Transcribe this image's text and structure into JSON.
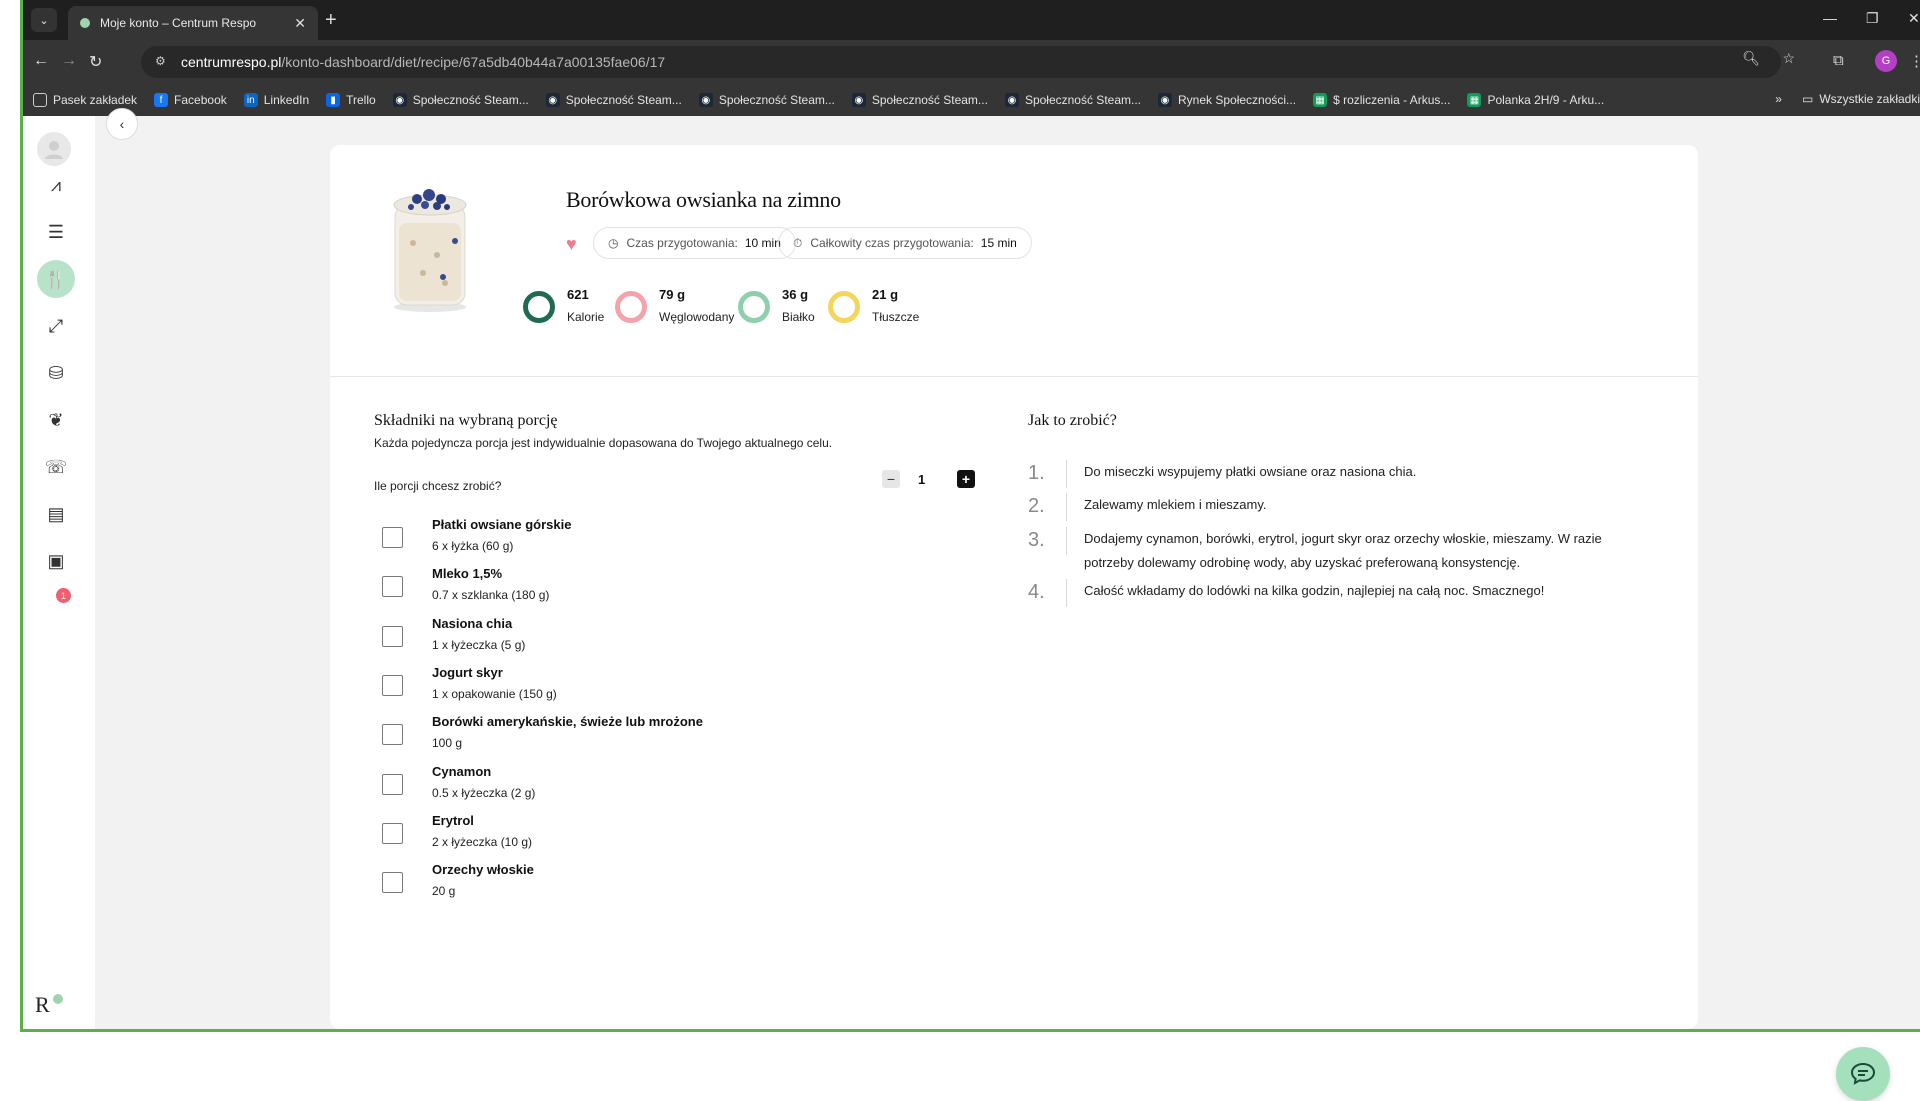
{
  "browser": {
    "tab_title": "Moje konto – Centrum Respo",
    "url_domain": "centrumrespo.pl",
    "url_path": "/konto-dashboard/diet/recipe/67a5db40b44a7a00135fae06/17",
    "profile_initial": "G",
    "bookmarks": [
      {
        "label": "Pasek zakładek",
        "icon": "folder-icon",
        "color": "#353535"
      },
      {
        "label": "Facebook",
        "icon": "facebook-icon",
        "color": "#1877f2"
      },
      {
        "label": "LinkedIn",
        "icon": "linkedin-icon",
        "color": "#0a66c2"
      },
      {
        "label": "Trello",
        "icon": "trello-icon",
        "color": "#0c66e4"
      },
      {
        "label": "Społeczność Steam...",
        "icon": "steam-icon",
        "color": "#1b2838"
      },
      {
        "label": "Społeczność Steam...",
        "icon": "steam-icon",
        "color": "#1b2838"
      },
      {
        "label": "Społeczność Steam...",
        "icon": "steam-icon",
        "color": "#1b2838"
      },
      {
        "label": "Społeczność Steam...",
        "icon": "steam-icon",
        "color": "#1b2838"
      },
      {
        "label": "Społeczność Steam...",
        "icon": "steam-icon",
        "color": "#1b2838"
      },
      {
        "label": "Rynek Społeczności...",
        "icon": "steam-icon",
        "color": "#1b2838"
      },
      {
        "label": "$ rozliczenia - Arkus...",
        "icon": "sheets-icon",
        "color": "#0f9d58"
      },
      {
        "label": "Polanka 2H/9 - Arku...",
        "icon": "sheets-icon",
        "color": "#0f9d58"
      }
    ],
    "all_bookmarks_label": "Wszystkie zakładki"
  },
  "sidebar": {
    "items": [
      {
        "name": "progress-chart-icon",
        "glyph": "⩘",
        "active": false
      },
      {
        "name": "chat-icon",
        "glyph": "☰",
        "active": false
      },
      {
        "name": "diet-cutlery-icon",
        "glyph": "🍴",
        "active": true
      },
      {
        "name": "training-dumbbell-icon",
        "glyph": "⤢",
        "active": false
      },
      {
        "name": "shopping-bag-icon",
        "glyph": "⛁",
        "active": false
      },
      {
        "name": "leaf-hand-icon",
        "glyph": "❦",
        "active": false
      },
      {
        "name": "phone-call-icon",
        "glyph": "☏",
        "active": false
      },
      {
        "name": "clipboard-icon",
        "glyph": "▤",
        "active": false
      },
      {
        "name": "archive-box-icon",
        "glyph": "▣",
        "active": false
      }
    ],
    "badge_count": "1",
    "logo": "R"
  },
  "recipe": {
    "title": "Borówkowa owsianka na zimno",
    "prep_label": "Czas przygotowania:",
    "prep_value": "10 min",
    "total_label": "Całkowity czas przygotowania:",
    "total_value": "15 min",
    "macros": [
      {
        "value": "621",
        "label": "Kalorie",
        "color": "#1f6b52"
      },
      {
        "value": "79 g",
        "label": "Węglowodany",
        "color": "#f4a3ab"
      },
      {
        "value": "36 g",
        "label": "Białko",
        "color": "#8fcfac"
      },
      {
        "value": "21 g",
        "label": "Tłuszcze",
        "color": "#f5d55a"
      }
    ]
  },
  "ingredients": {
    "title": "Składniki na wybraną porcję",
    "subtitle": "Każda pojedyncza porcja jest indywidualnie dopasowana do Twojego aktualnego celu.",
    "portion_label": "Ile porcji chcesz zrobić?",
    "portion_minus": "−",
    "portion_value": "1",
    "portion_plus": "+",
    "items": [
      {
        "name": "Płatki owsiane górskie",
        "qty": "6 x łyżka (60 g)"
      },
      {
        "name": "Mleko 1,5%",
        "qty": "0.7 x szklanka (180 g)"
      },
      {
        "name": "Nasiona chia",
        "qty": "1 x łyżeczka (5 g)"
      },
      {
        "name": "Jogurt skyr",
        "qty": "1 x opakowanie (150 g)"
      },
      {
        "name": "Borówki amerykańskie, świeże lub mrożone",
        "qty": "100 g"
      },
      {
        "name": "Cynamon",
        "qty": "0.5 x łyżeczka (2 g)"
      },
      {
        "name": "Erytrol",
        "qty": "2 x łyżeczka (10 g)"
      },
      {
        "name": "Orzechy włoskie",
        "qty": "20 g"
      }
    ]
  },
  "steps": {
    "title": "Jak to zrobić?",
    "items": [
      {
        "num": "1.",
        "text": "Do miseczki wsypujemy płatki owsiane oraz nasiona chia."
      },
      {
        "num": "2.",
        "text": "Zalewamy mlekiem i mieszamy."
      },
      {
        "num": "3.",
        "text": "Dodajemy cynamon, borówki, erytrol, jogurt skyr oraz orzechy włoskie, mieszamy. W razie potrzeby dolewamy odrobinę wody, aby uzyskać preferowaną konsystencję."
      },
      {
        "num": "4.",
        "text": "Całość wkładamy do lodówki na kilka godzin, najlepiej na całą noc. Smacznego!"
      }
    ]
  }
}
